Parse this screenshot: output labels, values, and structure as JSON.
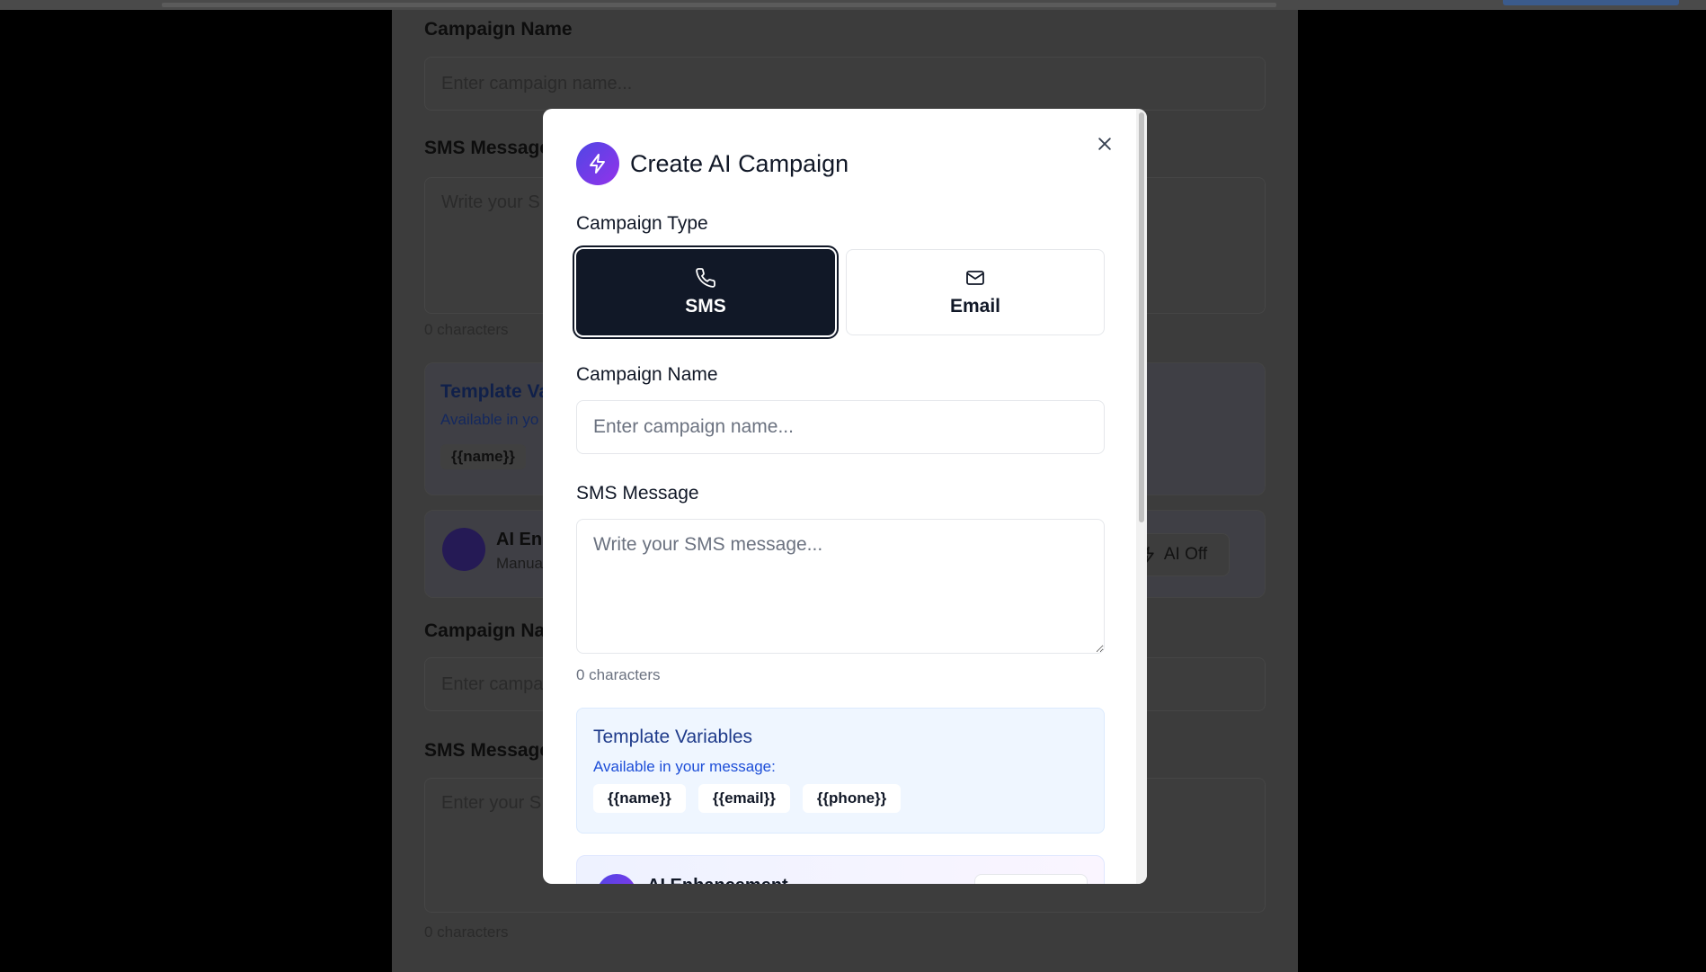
{
  "background": {
    "panel": {
      "campaign_name_label": "Campaign Name",
      "campaign_name_placeholder": "Enter campaign name...",
      "sms_message_label": "SMS Message",
      "sms_message_placeholder": "Write your S",
      "char_count": "0 characters",
      "template_title": "Template Va",
      "template_sub": "Available in yo",
      "template_chip": "{{name}}",
      "ai_title": "AI Enh",
      "ai_sub": "Manua",
      "ai_off_label": "AI Off",
      "campaign_name_label_2": "Campaign Na",
      "campaign_name_placeholder_2": "Enter campa",
      "sms_message_label_2": "SMS Message",
      "sms_message_placeholder_2": "Enter your S",
      "char_count_2": "0 characters"
    }
  },
  "modal": {
    "title": "Create AI Campaign",
    "campaign_type_label": "Campaign Type",
    "types": [
      {
        "label": "SMS",
        "icon": "phone-icon",
        "selected": true
      },
      {
        "label": "Email",
        "icon": "mail-icon",
        "selected": false
      }
    ],
    "campaign_name": {
      "label": "Campaign Name",
      "placeholder": "Enter campaign name...",
      "value": ""
    },
    "sms_message": {
      "label": "SMS Message",
      "placeholder": "Write your SMS message...",
      "value": ""
    },
    "char_count": "0 characters",
    "template_variables": {
      "title": "Template Variables",
      "subtitle": "Available in your message:",
      "variables": [
        "{{name}}",
        "{{email}}",
        "{{phone}}"
      ]
    },
    "ai_enhancement": {
      "title": "AI Enhancement"
    }
  },
  "colors": {
    "accent_gradient_start": "#4f46e5",
    "accent_gradient_end": "#9333ea",
    "selected_type_bg": "#111827",
    "template_box_bg": "#eff6ff",
    "template_title": "#1e3a8a"
  }
}
